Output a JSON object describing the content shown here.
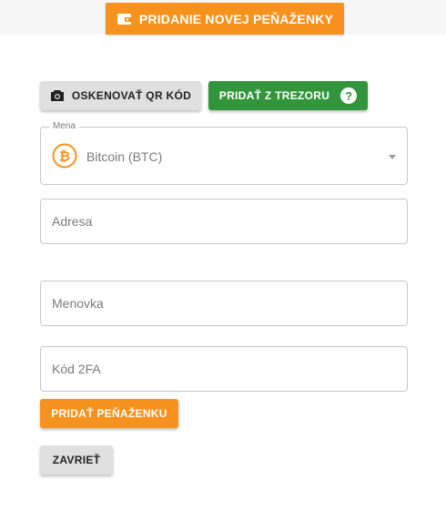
{
  "header": {
    "title": "PRIDANIE NOVEJ PEŇAŽENKY",
    "icon": "wallet-icon"
  },
  "toolbar": {
    "scan_label": "OSKENOVAŤ QR KÓD",
    "scan_icon": "camera-icon",
    "trezor_label": "PRIDAŤ Z TREZORU",
    "trezor_help_icon": "question-circle-icon"
  },
  "form": {
    "currency_legend": "Mena",
    "currency_value": "Bitcoin (BTC)",
    "currency_icon": "bitcoin-icon",
    "address_placeholder": "Adresa",
    "label_placeholder": "Menovka",
    "twofa_placeholder": "Kód 2FA"
  },
  "actions": {
    "add_label": "PRIDAŤ PEŇAŽENKU",
    "close_label": "ZAVRIEŤ"
  },
  "colors": {
    "accent": "#f7921e",
    "green": "#33953b",
    "gray_button": "#e0e0e0"
  }
}
